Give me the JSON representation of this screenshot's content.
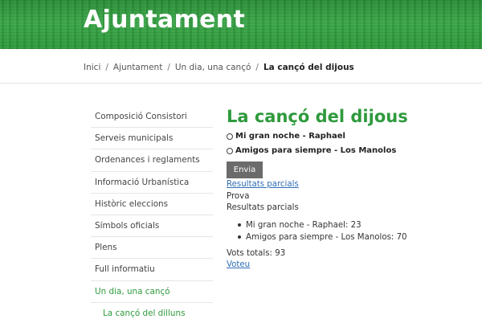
{
  "header": {
    "title": "Ajuntament"
  },
  "breadcrumb": {
    "items": [
      "Inici",
      "Ajuntament",
      "Un dia, una cançó"
    ],
    "current": "La cançó del dijous",
    "separator": "/"
  },
  "sidebar": {
    "items": [
      {
        "label": "Composició Consistori"
      },
      {
        "label": "Serveis municipals"
      },
      {
        "label": "Ordenances i reglaments"
      },
      {
        "label": "Informació Urbanística"
      },
      {
        "label": "Històric eleccions"
      },
      {
        "label": "Símbols oficials"
      },
      {
        "label": "Plens"
      },
      {
        "label": "Full informatiu"
      },
      {
        "label": "Un dia, una cançó"
      }
    ],
    "subitem": "La cançó del dilluns"
  },
  "poll": {
    "title": "La cançó del dijous",
    "options": [
      "Mi gran noche - Raphael",
      "Amigos para siempre - Los Manolos"
    ],
    "submit_label": "Envia",
    "partial_results_link": "Resultats parcials",
    "prova": "Prova",
    "results_heading": "Resultats parcials",
    "results": [
      "Mi gran noche - Raphael: 23",
      "Amigos para siempre - Los Manolos: 70"
    ],
    "total_votes": "Vots totals: 93",
    "vote_link": "Voteu"
  },
  "colors": {
    "brand_green": "#2f9a3d",
    "button_gray": "#6b6b6b",
    "link_blue": "#2e6db4"
  }
}
